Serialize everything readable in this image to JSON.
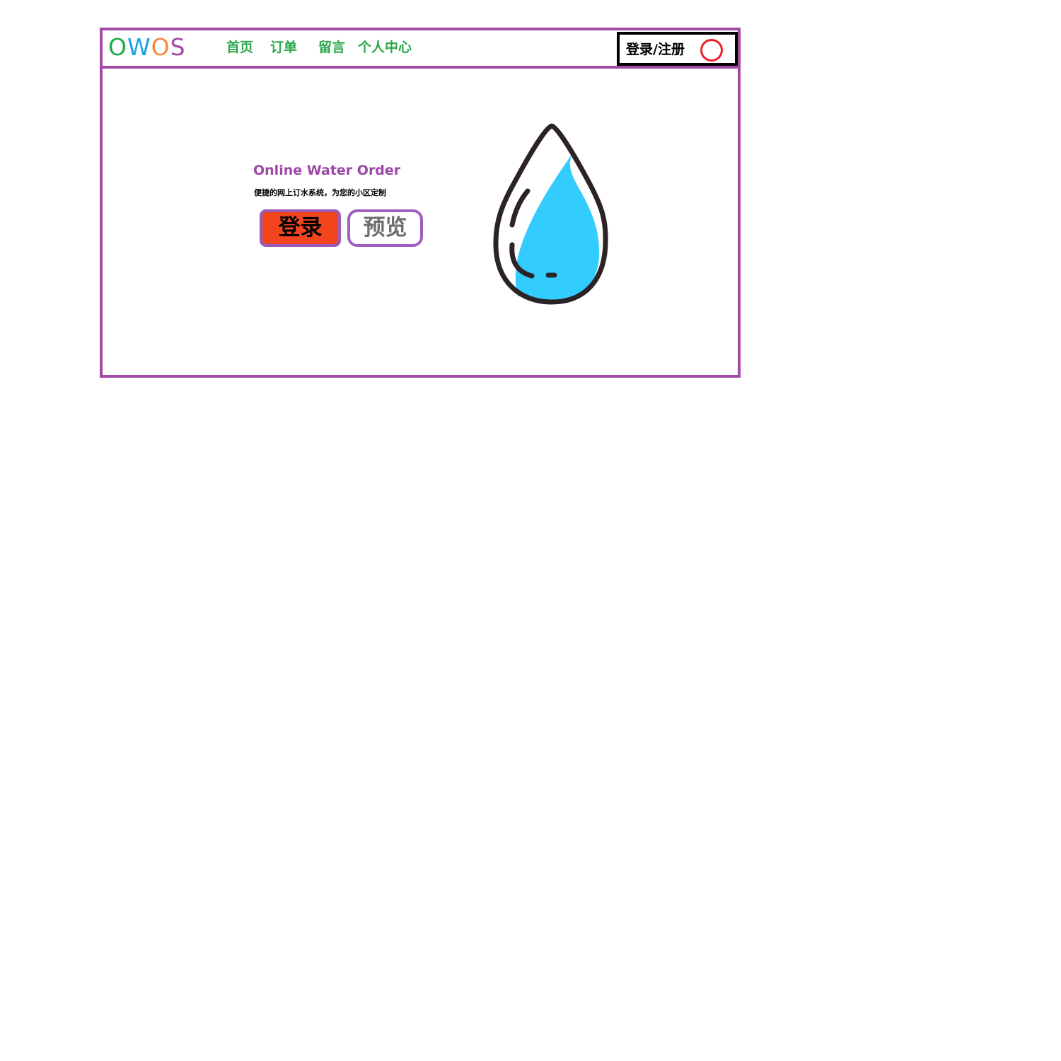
{
  "colors": {
    "frame_border": "#a34aa5",
    "nav_text": "#2aa84a",
    "hero_title": "#9b48a6",
    "login_button_bg": "#f2451e",
    "preview_button_text": "#6e6e6e",
    "user_icon": "#e8202a",
    "drop_fill": "#33ccff",
    "drop_outline": "#2b2325"
  },
  "header": {
    "logo": [
      {
        "char": "O",
        "color": "#22aa4a"
      },
      {
        "char": "W",
        "color": "#19a4e6"
      },
      {
        "char": "O",
        "color": "#f7873a"
      },
      {
        "char": "S",
        "color": "#a34aa5"
      }
    ],
    "nav": [
      "首页",
      "订单",
      "留言",
      "个人中心"
    ],
    "auth_label": "登录/注册",
    "user_icon": "user-circle-icon"
  },
  "hero": {
    "title": "Online Water Order",
    "subtitle": "便捷的网上订水系统，为您的小区定制",
    "login_button": "登录",
    "preview_button": "预览",
    "illustration": "water-drop-icon"
  }
}
